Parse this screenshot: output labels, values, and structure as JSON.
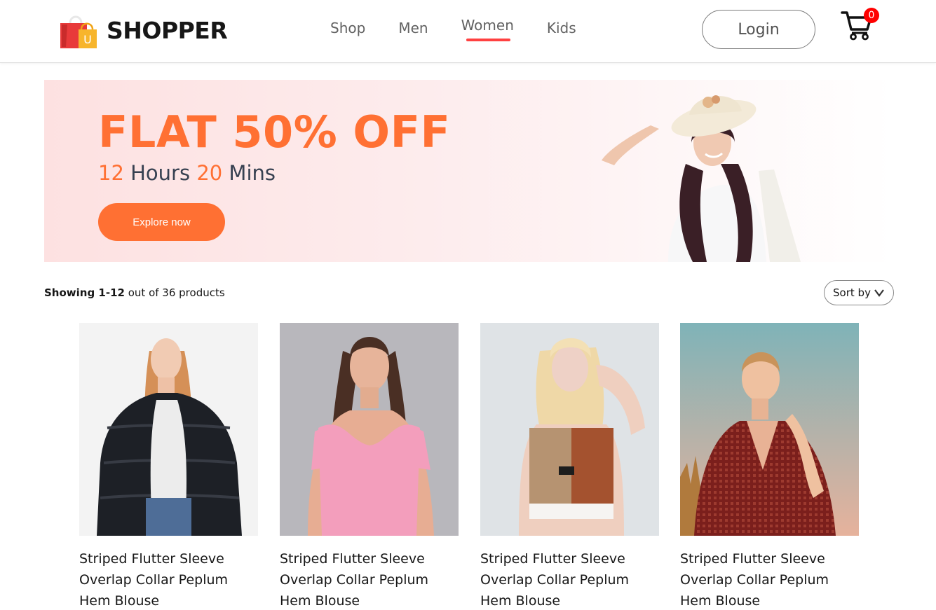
{
  "navbar": {
    "brand": "SHOPPER",
    "logo_letter": "U",
    "menu": [
      {
        "label": "Shop",
        "active": false
      },
      {
        "label": "Men",
        "active": false
      },
      {
        "label": "Women",
        "active": true
      },
      {
        "label": "Kids",
        "active": false
      }
    ],
    "login_label": "Login",
    "cart_count": "0",
    "icons": {
      "logo": "shopping-bag-icon",
      "cart": "cart-icon"
    }
  },
  "banner": {
    "headline": "FLAT 50% OFF",
    "timer": {
      "hours_value": "12",
      "hours_label": " Hours ",
      "mins_value": "20",
      "mins_label": " Mins"
    },
    "cta_label": "Explore now"
  },
  "listing": {
    "showing_bold": "Showing 1-12",
    "showing_rest": " out of 36 products",
    "sort_label": "Sort by",
    "sort_icon": "chevron-down-icon"
  },
  "products": [
    {
      "name": "Striped Flutter Sleeve Overlap Collar Peplum Hem Blouse"
    },
    {
      "name": "Striped Flutter Sleeve Overlap Collar Peplum Hem Blouse"
    },
    {
      "name": "Striped Flutter Sleeve Overlap Collar Peplum Hem Blouse"
    },
    {
      "name": "Striped Flutter Sleeve Overlap Collar Peplum Hem Blouse"
    }
  ],
  "colors": {
    "accent": "#ff7033",
    "nav_underline": "#ff4141",
    "cart_badge": "#ff0000"
  }
}
